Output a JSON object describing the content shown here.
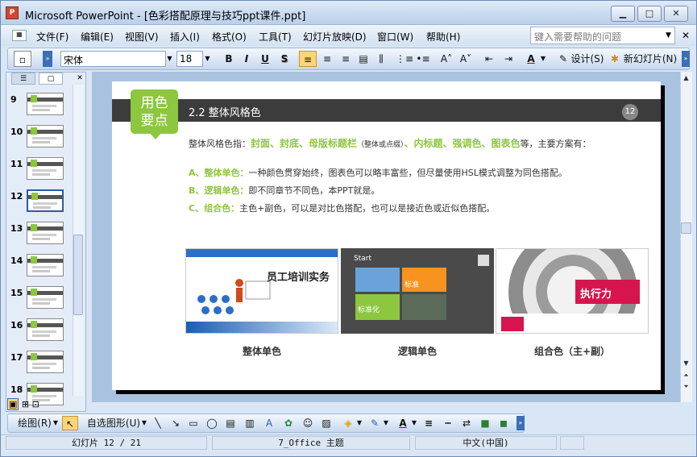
{
  "window": {
    "title": "Microsoft PowerPoint - [色彩搭配原理与技巧ppt课件.ppt]",
    "app_icon": "P"
  },
  "menu": [
    "文件(F)",
    "编辑(E)",
    "视图(V)",
    "插入(I)",
    "格式(O)",
    "工具(T)",
    "幻灯片放映(D)",
    "窗口(W)",
    "帮助(H)"
  ],
  "help": {
    "placeholder": "键入需要帮助的问题"
  },
  "toolbar": {
    "font_name": "宋体",
    "font_size": "18",
    "bold": "B",
    "italic": "I",
    "underline": "U",
    "shadow": "S",
    "design_label": "设计(S)",
    "new_slide_label": "新幻灯片(N)"
  },
  "thumbnails": {
    "numbers": [
      "9",
      "10",
      "11",
      "12",
      "13",
      "14",
      "15",
      "16",
      "17",
      "18"
    ],
    "selected": "12"
  },
  "slide": {
    "badge": "用色\n要点",
    "title": "2.2 整体风格色",
    "number": "12",
    "intro_prefix": "整体风格色指：",
    "intro_highlight1": "封面、封底、母版标题栏",
    "intro_note": "（整体或点缀）",
    "intro_sep": "、",
    "intro_highlight2": "内标题、强调色、图表色",
    "intro_suffix": "等，主要方案有：",
    "lines": [
      {
        "label": "A、整体单色：",
        "text": "一种颜色贯穿始终，图表色可以略丰富些，但尽量使用HSL模式调整为同色搭配。"
      },
      {
        "label": "B、逻辑单色：",
        "text": "即不同章节不同色，本PPT就是。"
      },
      {
        "label": "C、组合色：",
        "text": "主色+副色，可以是对比色搭配，也可以是接近色或近似色搭配。"
      }
    ],
    "images": {
      "img1_title": "员工培训实务",
      "img2_start": "Start",
      "img2_tile1": "标准",
      "img2_tile2": "标准化",
      "img3_title": "执行力"
    },
    "captions": [
      "整体单色",
      "逻辑单色",
      "组合色（主+副）"
    ]
  },
  "drawbar": {
    "draw_label": "绘图(R)",
    "autoshape_label": "自选图形(U)"
  },
  "status": {
    "slide_info": "幻灯片 12 / 21",
    "theme": "7_Office 主题",
    "language": "中文(中国)"
  },
  "colors": {
    "accent_green": "#8dc63f",
    "header_dark": "#3c3c3c",
    "chrome_blue": "#c5d9f1"
  }
}
